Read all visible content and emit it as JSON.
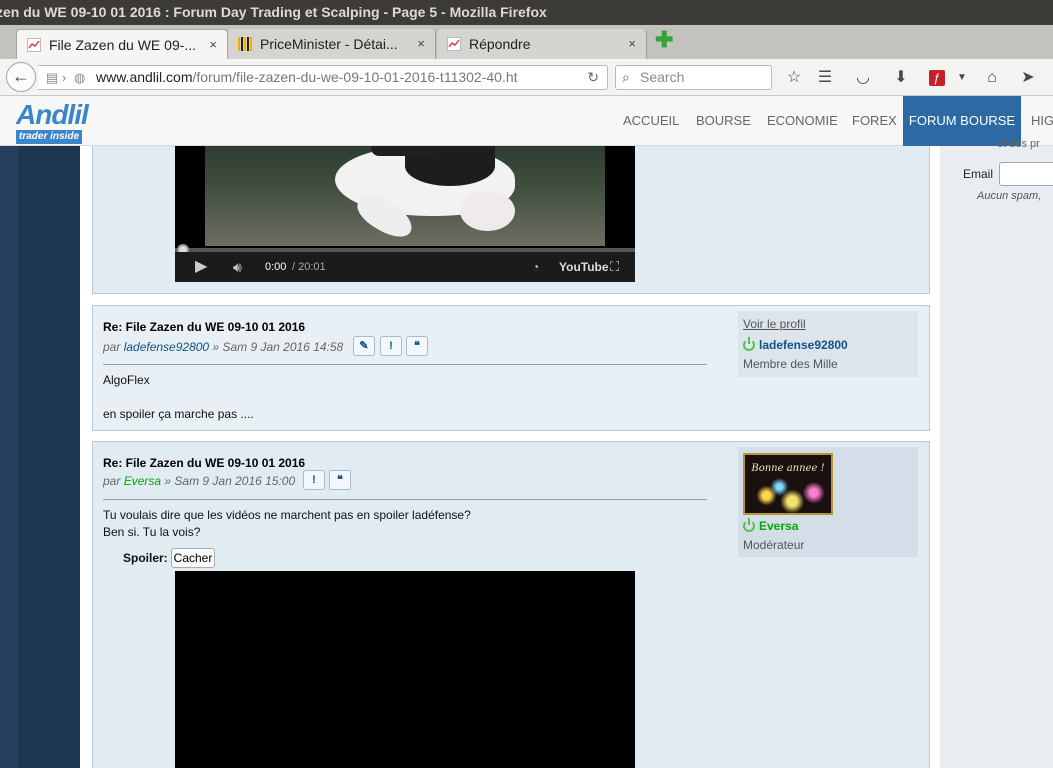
{
  "window": {
    "title": "zen du WE 09-10 01 2016 : Forum Day Trading et Scalping - Page 5 - Mozilla Firefox"
  },
  "tabs": [
    {
      "label": "File Zazen du WE 09-...",
      "close": "×",
      "icon": "chart-favicon-icon"
    },
    {
      "label": "PriceMinister - Détai...",
      "close": "×",
      "icon": "priceminister-favicon-icon"
    },
    {
      "label": "Répondre",
      "close": "×",
      "icon": "chart-favicon-icon"
    }
  ],
  "newtab": "✚",
  "toolbar": {
    "back": "←",
    "url_host": "www.andlil.com",
    "url_path": "/forum/file-zazen-du-we-09-10-01-2016-t11302-40.ht",
    "reload": "↻",
    "search_placeholder": "Search",
    "search_icon": "🔍"
  },
  "site": {
    "logo_top": "Andlil",
    "logo_bottom": "trader inside",
    "nav": [
      "ACCUEIL",
      "BOURSE",
      "ECONOMIE",
      "FOREX",
      "FORUM BOURSE",
      "HIG"
    ]
  },
  "sidebar": {
    "top_text": "et des pr",
    "email_label": "Email",
    "note": "Aucun spam, "
  },
  "video1": {
    "time_current": "0:00",
    "time_total": "/ 20:01",
    "brand": "YouTube"
  },
  "posts": [
    {
      "title": "Re: File Zazen du WE 09-10 01 2016",
      "by": "par",
      "author": "ladefense92800",
      "date": "» Sam 9 Jan 2016 14:58",
      "buttons": [
        "✎",
        "!",
        "❝"
      ],
      "lines": [
        "AlgoFlex",
        "en spoiler ça marche pas ...."
      ],
      "profile_link": "Voir le profil",
      "rank": "Membre des Mille"
    },
    {
      "title": "Re: File Zazen du WE 09-10 01 2016",
      "by": "par",
      "author": "Eversa",
      "date": "» Sam 9 Jan 2016 15:00",
      "buttons": [
        "!",
        "❝"
      ],
      "lines": [
        "Tu voulais dire que les vidéos ne marchent pas en spoiler ladéfense?",
        "Ben si. Tu la vois?"
      ],
      "spoiler_label": "Spoiler:",
      "spoiler_button": "Cacher",
      "avatar_text": "Bonne annee !",
      "rank": "Modérateur"
    }
  ]
}
